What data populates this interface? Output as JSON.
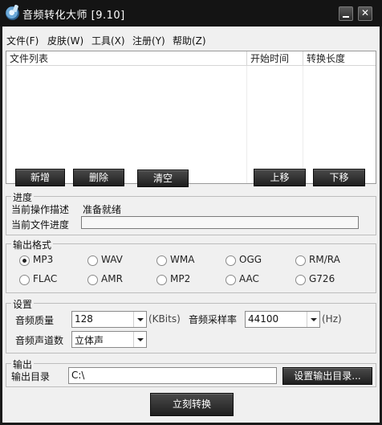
{
  "window": {
    "title": "音频转化大师 [9.10]"
  },
  "menu": [
    {
      "label": "文件(F)"
    },
    {
      "label": "皮肤(W)"
    },
    {
      "label": "工具(X)"
    },
    {
      "label": "注册(Y)"
    },
    {
      "label": "帮助(Z)"
    }
  ],
  "filelist": {
    "col_name": "文件列表",
    "col_start": "开始时间",
    "col_length": "转换长度"
  },
  "toolbar": {
    "add": "新增",
    "delete": "删除",
    "clear": "清空",
    "up": "上移",
    "down": "下移"
  },
  "progress": {
    "group_title": "进度",
    "op_label": "当前操作描述",
    "op_value": "准备就绪",
    "file_label": "当前文件进度",
    "file_fraction": 0.0
  },
  "output_format": {
    "group_title": "输出格式",
    "selected": "MP3",
    "options_row1": [
      "MP3",
      "WAV",
      "WMA",
      "OGG",
      "RM/RA"
    ],
    "options_row2": [
      "FLAC",
      "AMR",
      "MP2",
      "AAC",
      "G726"
    ]
  },
  "settings": {
    "group_title": "设置",
    "quality_label": "音频质量",
    "quality_value": "128",
    "quality_unit": "(KBits)",
    "rate_label": "音频采样率",
    "rate_value": "44100",
    "rate_unit": "(Hz)",
    "channel_label": "音频声道数",
    "channel_value": "立体声"
  },
  "output": {
    "group_title": "输出",
    "dir_label": "输出目录",
    "dir_value": "C:\\",
    "set_dir_button": "设置输出目录..."
  },
  "convert_button": "立刻转换"
}
